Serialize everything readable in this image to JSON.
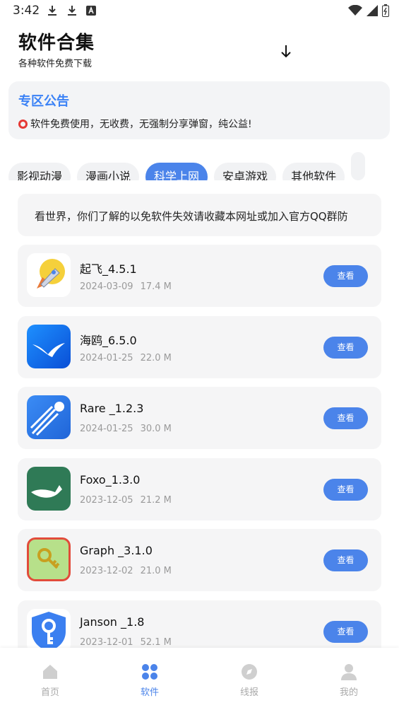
{
  "status_bar": {
    "time": "3:42"
  },
  "header": {
    "title": "软件合集",
    "subtitle": "各种软件免费下载"
  },
  "notice": {
    "title": "专区公告",
    "text": "软件免费使用，无收费，无强制分享弹窗，纯公益!"
  },
  "tabs": [
    {
      "label": "影视动漫"
    },
    {
      "label": "漫画小说"
    },
    {
      "label": "科学上网"
    },
    {
      "label": "安卓游戏"
    },
    {
      "label": "其他软件"
    },
    {
      "label": ""
    }
  ],
  "active_tab": "科学上网",
  "marquee": {
    "text": "看世界，你们了解的以免软件失效请收藏本网址或加入官方QQ群防"
  },
  "apps": [
    {
      "name": "起飞_4.5.1",
      "date": "2024-03-09",
      "size": "17.4 M",
      "button": "查看",
      "icon": "rocket-icon"
    },
    {
      "name": "海鸥_6.5.0",
      "date": "2024-01-25",
      "size": "22.0 M",
      "button": "查看",
      "icon": "seagull-icon"
    },
    {
      "name": "Rare _1.2.3",
      "date": "2024-01-25",
      "size": "30.0 M",
      "button": "查看",
      "icon": "comet-icon"
    },
    {
      "name": "Foxo_1.3.0",
      "date": "2023-12-05",
      "size": "21.2 M",
      "button": "查看",
      "icon": "fox-icon"
    },
    {
      "name": "Graph _3.1.0",
      "date": "2023-12-02",
      "size": "21.0 M",
      "button": "查看",
      "icon": "keys-icon"
    },
    {
      "name": "Janson _1.8",
      "date": "2023-12-01",
      "size": "52.1 M",
      "button": "查看",
      "icon": "key-shield-icon"
    }
  ],
  "bottom_nav": [
    {
      "label": "首页",
      "icon": "home-icon"
    },
    {
      "label": "软件",
      "icon": "grid-icon"
    },
    {
      "label": "线报",
      "icon": "compass-icon"
    },
    {
      "label": "我的",
      "icon": "user-icon"
    }
  ],
  "colors": {
    "accent": "#4b84ea",
    "card_bg": "#f5f5f6",
    "meta_text": "#9a9a9a"
  }
}
